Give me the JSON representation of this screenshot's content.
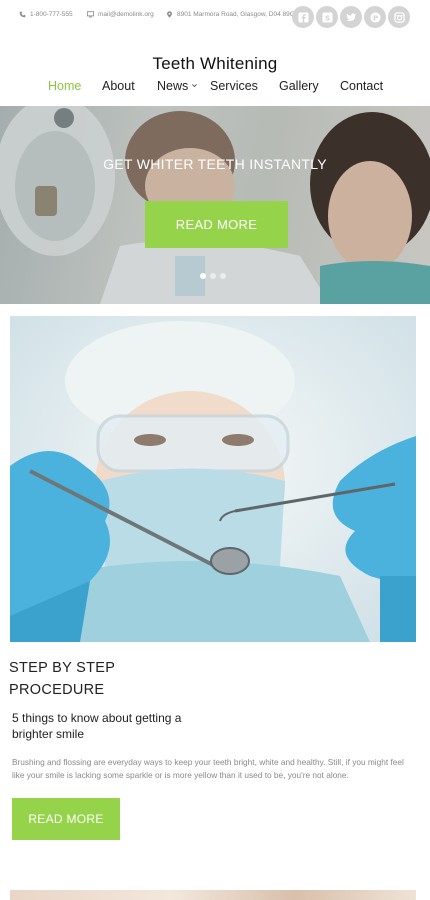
{
  "topbar": {
    "phone": "1-800-777-555",
    "email": "mail@demolink.org",
    "address": "8901 Marmora Road, Glasgow, D04 89GR."
  },
  "socials": [
    "facebook-icon",
    "skype-icon",
    "twitter-icon",
    "pinterest-icon",
    "instagram-icon"
  ],
  "brand": {
    "title": "Teeth Whitening"
  },
  "nav": {
    "items": [
      {
        "label": "Home",
        "active": true
      },
      {
        "label": "About"
      },
      {
        "label": "News",
        "has_dropdown": true
      },
      {
        "label": "Services"
      },
      {
        "label": "Gallery"
      },
      {
        "label": "Contact"
      }
    ]
  },
  "hero": {
    "title": "GET WHITER TEETH INSTANTLY",
    "button_label": "READ MORE",
    "slide_count": 3,
    "active_slide": 1
  },
  "article": {
    "title_line1": "STEP BY STEP",
    "title_line2": "PROCEDURE",
    "subtitle_line1": "5 things to know about getting a",
    "subtitle_line2": "brighter smile",
    "body": "Brushing and flossing are everyday ways to keep your teeth bright, white and healthy. Still, if you might feel like your smile is lacking some sparkle or is more yellow than it used to be, you're not alone.",
    "button_label": "READ MORE"
  },
  "colors": {
    "accent": "#95d44a",
    "active_nav": "#8bc53f",
    "social_bg": "#d4d4d4"
  }
}
